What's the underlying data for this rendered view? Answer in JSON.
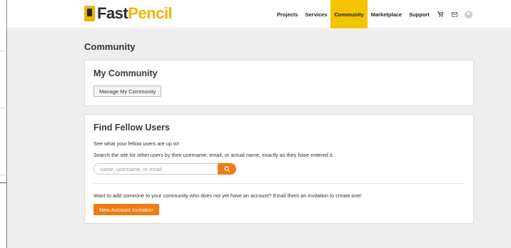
{
  "brand": {
    "name_part1": "Fast",
    "name_part2": "Pencil",
    "accent": "#f0b400"
  },
  "nav": {
    "items": [
      {
        "label": "Projects"
      },
      {
        "label": "Services"
      },
      {
        "label": "Community",
        "active": true
      },
      {
        "label": "Marketplace"
      },
      {
        "label": "Support"
      }
    ],
    "icons": [
      "cart-icon",
      "mail-icon",
      "user-avatar-icon"
    ]
  },
  "page": {
    "title": "Community"
  },
  "my_community": {
    "title": "My Community",
    "manage_button": "Manage My Community"
  },
  "find_users": {
    "title": "Find Fellow Users",
    "line1": "See what your fellow users are up to!",
    "line2": "Search the site for other users by their username, email, or actual name, exactly as they have entered it.",
    "search_placeholder": "name, username, or email",
    "invite_text": "Want to add someone to your community who does not yet have an account? Email them an invitation to create one!",
    "invite_button": "New Account Invitation"
  },
  "colors": {
    "orange": "#f07a14",
    "nav_active": "#f5c400",
    "background": "#eeeeee"
  }
}
